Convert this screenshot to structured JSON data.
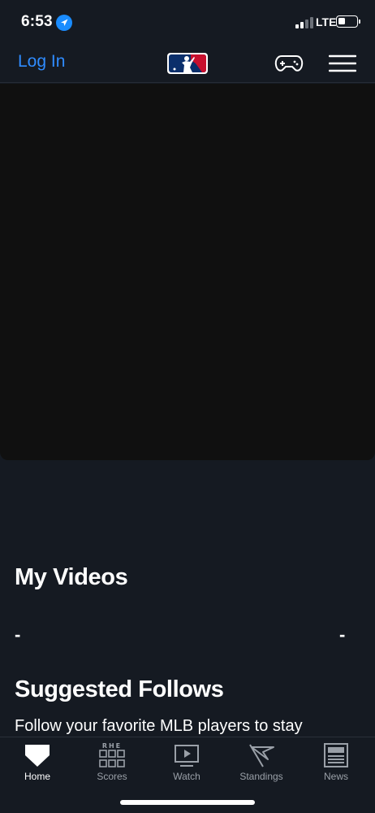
{
  "status_bar": {
    "time": "6:53",
    "network": "LTE",
    "icons": [
      "location-arrow-icon",
      "signal-icon",
      "battery-icon"
    ]
  },
  "header": {
    "login_label": "Log In",
    "icons": [
      "mlb-logo",
      "game-controller-icon",
      "hamburger-menu-icon"
    ]
  },
  "sections": {
    "my_videos_title": "My Videos",
    "dash_left": "-",
    "dash_right": "-",
    "suggested_title": "Suggested Follows",
    "suggested_text": "Follow your favorite MLB players to stay"
  },
  "tabs": [
    {
      "label": "Home",
      "icon": "home-plate-icon",
      "active": true
    },
    {
      "label": "Scores",
      "icon": "scores-grid-icon",
      "active": false
    },
    {
      "label": "Watch",
      "icon": "watch-play-icon",
      "active": false
    },
    {
      "label": "Standings",
      "icon": "pennant-flag-icon",
      "active": false
    },
    {
      "label": "News",
      "icon": "newspaper-icon",
      "active": false
    }
  ],
  "colors": {
    "background": "#151a22",
    "accent": "#2f8cff",
    "hero": "#101010",
    "mlb_blue": "#0b2f6b",
    "mlb_red": "#c8102e"
  }
}
